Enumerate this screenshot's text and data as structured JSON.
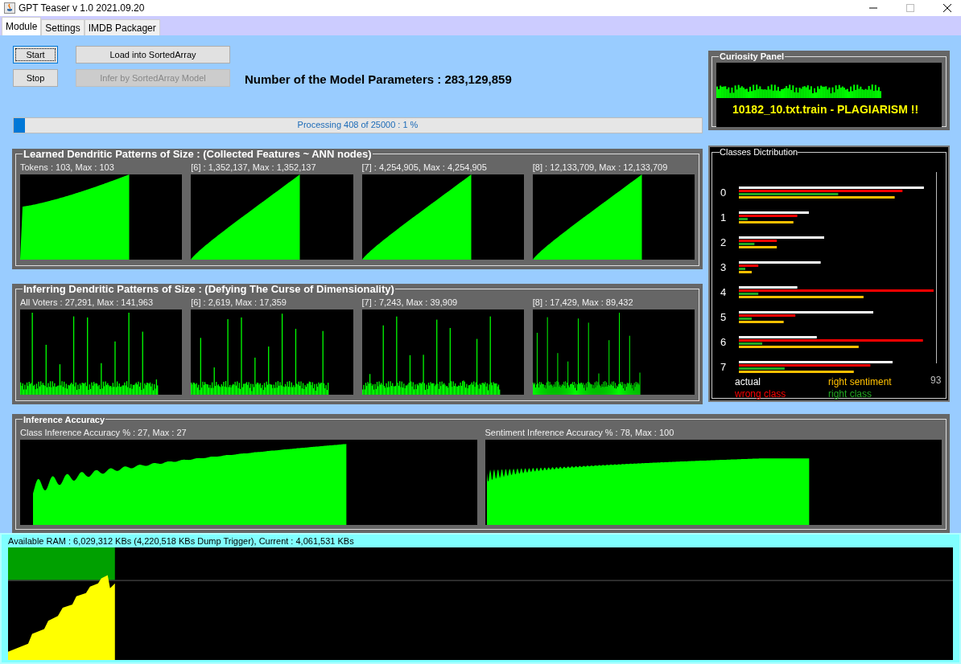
{
  "window": {
    "title": "GPT Teaser v 1.0 2021.09.20"
  },
  "tabs": [
    {
      "label": "Module",
      "selected": true
    },
    {
      "label": "Settings",
      "selected": false
    },
    {
      "label": "IMDB Packager",
      "selected": false
    }
  ],
  "buttons": [
    {
      "label": "Start",
      "focused": true,
      "disabled": false
    },
    {
      "label": "Load into SortedArray",
      "focused": false,
      "disabled": false
    },
    {
      "label": "Stop",
      "focused": false,
      "disabled": false
    },
    {
      "label": "Infer by SortedArray Model",
      "focused": false,
      "disabled": true
    }
  ],
  "parameters": "Number of the Model Parameters : 283,129,859",
  "progress": {
    "text": "Processing 408 of 25000 : 1 %",
    "level": 0.016
  },
  "learned_panel": {
    "title": "Learned Dendritic Patterns of Size : (Collected Features ~ ANN nodes)",
    "charts": [
      {
        "label": "Tokens : 103, Max : 103"
      },
      {
        "label": "[6]  : 1,352,137, Max : 1,352,137"
      },
      {
        "label": "[7]  : 4,254,905, Max : 4,254,905"
      },
      {
        "label": "[8]  : 12,133,709, Max : 12,133,709"
      }
    ]
  },
  "inferring_panel": {
    "title": "Inferring Dendritic Patterns of Size : (Defying The Curse of Dimensionality)",
    "charts": [
      {
        "label": "All Voters : 27,291, Max : 141,963"
      },
      {
        "label": "[6] : 2,619, Max : 17,359"
      },
      {
        "label": "[7] : 7,243, Max : 39,909"
      },
      {
        "label": "[8] : 17,429, Max : 89,432"
      }
    ]
  },
  "curiosity_panel": {
    "title": "Curiosity Panel",
    "message": "10182_10.txt.train - PLAGIARISM !!"
  },
  "classes_panel": {
    "title": "Classes Dictribution",
    "classes": [
      "0",
      "1",
      "2",
      "3",
      "4",
      "5",
      "6",
      "7"
    ],
    "axis_max": "93",
    "legend": [
      {
        "label": "actual",
        "color": "#ffffff"
      },
      {
        "label": "right sentiment",
        "color": "#ffc000"
      },
      {
        "label": "wrong class",
        "color": "#ff0000"
      },
      {
        "label": "right class",
        "color": "#22a822"
      }
    ]
  },
  "accuracy_panel": {
    "title": "Inference Accuracy",
    "charts": [
      {
        "label": "Class Inference Accuracy %  : 27, Max : 27"
      },
      {
        "label": "Sentiment Inference Accuracy %  : 78, Max : 100"
      }
    ]
  },
  "memory": {
    "text": "Available RAM : 6,029,312 KBs (4,220,518 KBs Dump Trigger), Current : 4,061,531 KBs"
  }
}
